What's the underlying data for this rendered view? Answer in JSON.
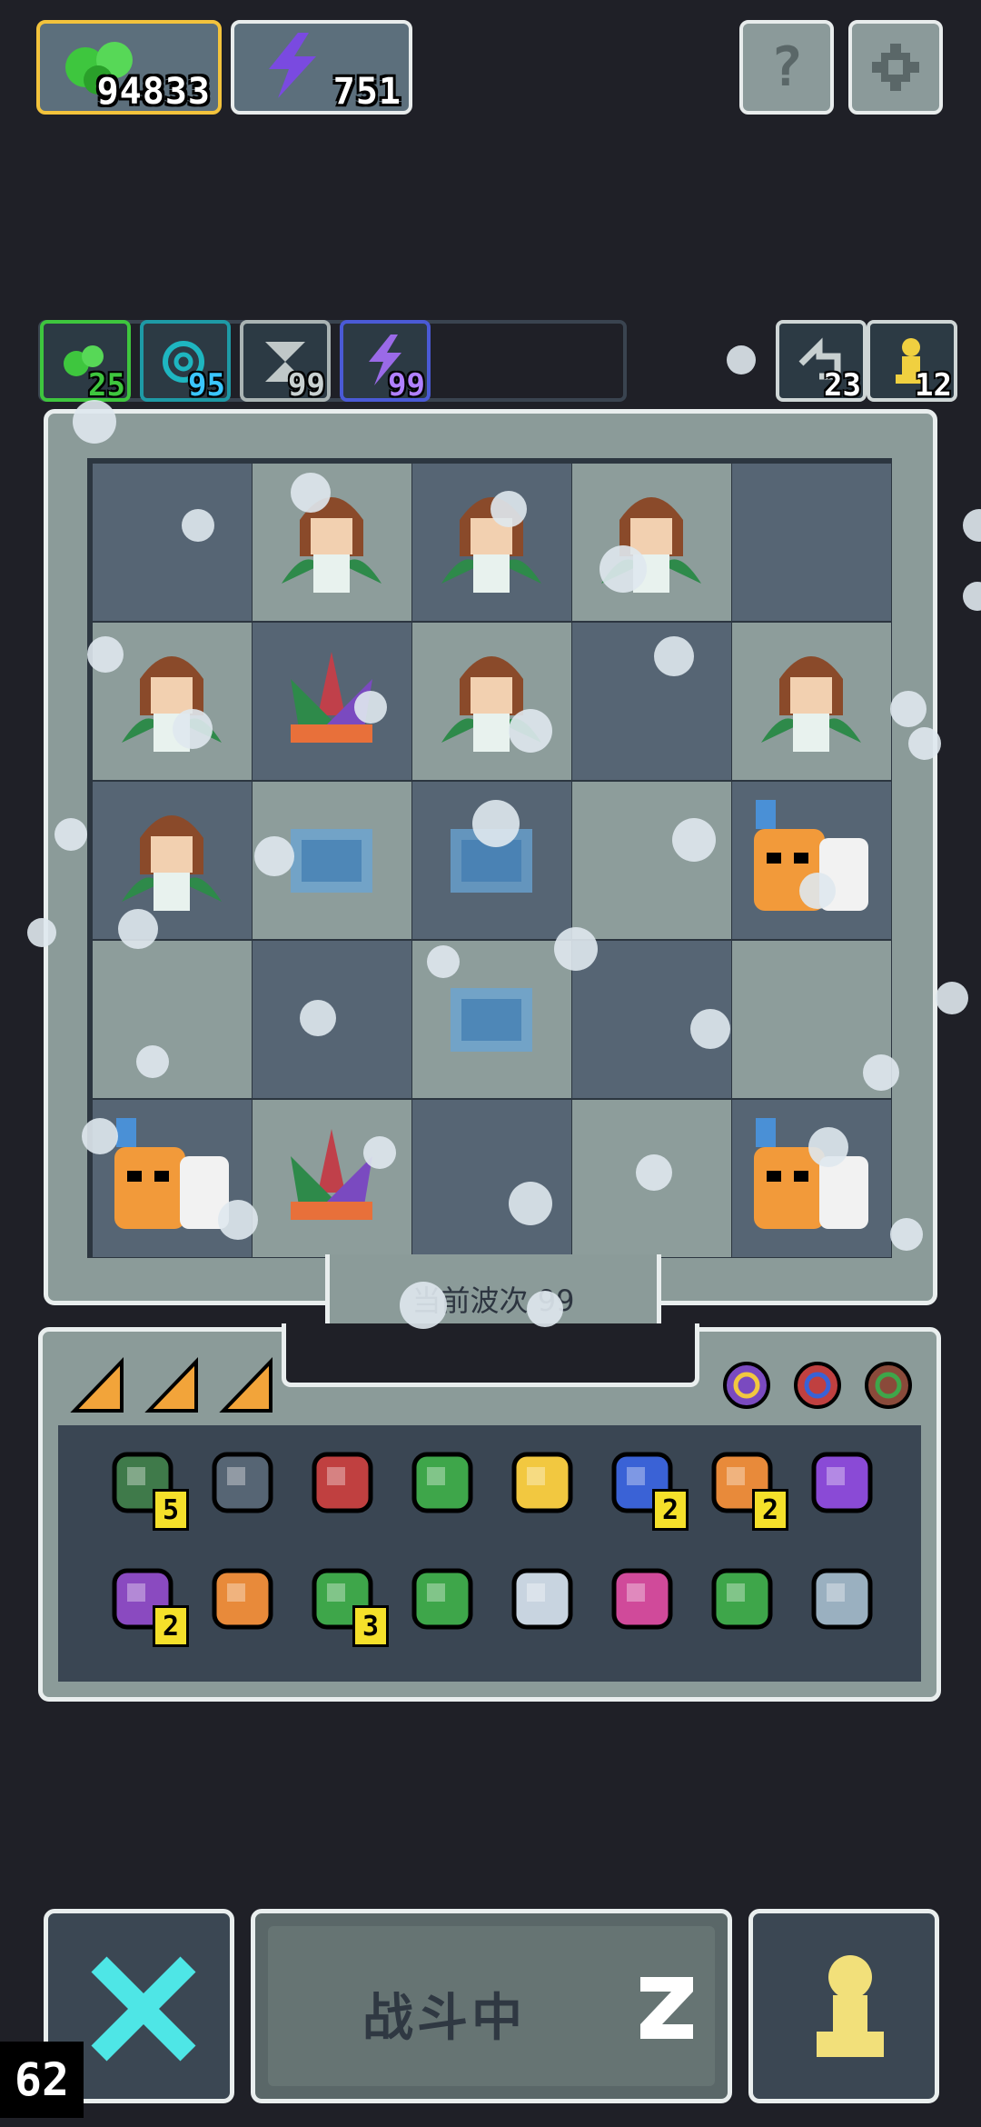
{
  "resources": {
    "seeds": {
      "value": "94833",
      "icon": "green-seed-icon"
    },
    "energy": {
      "value": "751",
      "icon": "lightning-icon"
    }
  },
  "top_buttons": {
    "help_icon": "question-icon",
    "settings_icon": "gear-icon"
  },
  "stat_chips": [
    {
      "icon": "seed-icon",
      "value": "25"
    },
    {
      "icon": "spiral-icon",
      "value": "95"
    },
    {
      "icon": "hourglass-icon",
      "value": "99"
    },
    {
      "icon": "lightning-icon",
      "value": "99"
    }
  ],
  "right_chips": [
    {
      "icon": "undo-icon",
      "value": "23"
    },
    {
      "icon": "pawn-icon",
      "value": "12"
    }
  ],
  "board": {
    "cols": 5,
    "rows": 5,
    "cells": [
      "",
      "girl",
      "girl",
      "girl",
      "",
      "girl",
      "plant",
      "girl",
      "",
      "girl",
      "girl",
      "ice",
      "ice",
      "",
      "tiger",
      "",
      "",
      "ice",
      "",
      "",
      "tiger",
      "plant",
      "",
      "",
      "tiger"
    ]
  },
  "wave": {
    "label": "当前波次 99"
  },
  "inventory": {
    "tabs": [
      "cheese-icon",
      "cheese-icon",
      "cheese-icon"
    ],
    "rings": [
      "gold-ring-icon",
      "blue-ring-icon",
      "green-ring-icon"
    ],
    "items": [
      {
        "icon": "zombie-icon",
        "count": "5",
        "color": "#3f7a4a"
      },
      {
        "icon": "shield-icon",
        "count": "",
        "color": "#566574"
      },
      {
        "icon": "mask-icon",
        "count": "",
        "color": "#c04040"
      },
      {
        "icon": "sword-icon",
        "count": "",
        "color": "#3ea64a"
      },
      {
        "icon": "dagger-icon",
        "count": "",
        "color": "#f2c840"
      },
      {
        "icon": "hourglass-icon",
        "count": "2",
        "color": "#3a62d6"
      },
      {
        "icon": "scroll-icon",
        "count": "2",
        "color": "#e88a3a"
      },
      {
        "icon": "wand-icon",
        "count": "",
        "color": "#8a4ad6"
      },
      {
        "icon": "potion-icon",
        "count": "2",
        "color": "#8a4ac0"
      },
      {
        "icon": "crown-icon",
        "count": "",
        "color": "#e88a3a"
      },
      {
        "icon": "vine-icon",
        "count": "3",
        "color": "#3ea64a"
      },
      {
        "icon": "arrow-icon",
        "count": "",
        "color": "#3ea64a"
      },
      {
        "icon": "mirror-icon",
        "count": "",
        "color": "#c8d4e0"
      },
      {
        "icon": "pink-arrow-icon",
        "count": "",
        "color": "#d04a9a"
      },
      {
        "icon": "chest-icon",
        "count": "",
        "color": "#3ea64a"
      },
      {
        "icon": "spikes-icon",
        "count": "",
        "color": "#9ab0c0"
      }
    ]
  },
  "bottom": {
    "left_icon": "crossed-swords-icon",
    "fight_label": "战斗中",
    "sleep_icon": "z-icon",
    "right_icon": "pawn-icon",
    "corner_counter": "62"
  }
}
